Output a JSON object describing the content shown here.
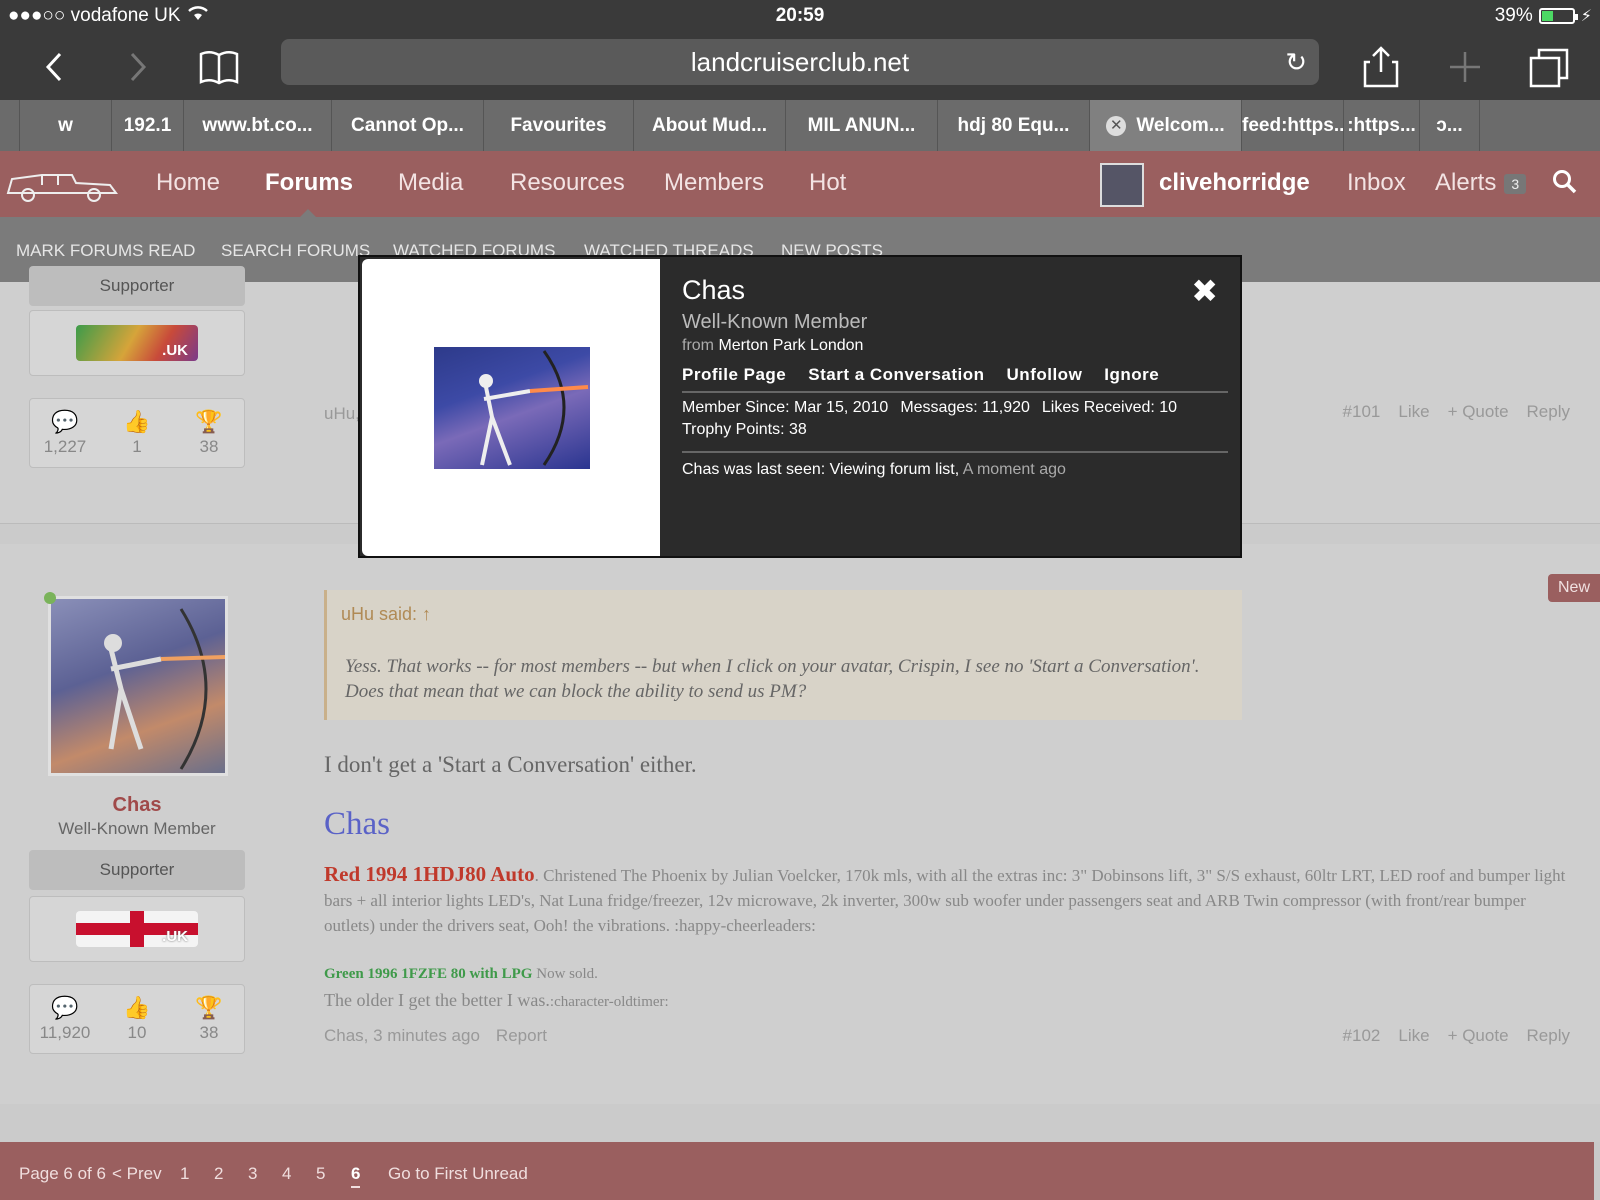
{
  "status_bar": {
    "carrier": "●●●○○ vodafone UK",
    "time": "20:59",
    "battery_percent": "39%",
    "battery_level": 0.39
  },
  "browser": {
    "url": "landcruiserclub.net",
    "tabs": [
      {
        "label": "w"
      },
      {
        "label": "192.1"
      },
      {
        "label": "www.bt.co..."
      },
      {
        "label": "Cannot Op..."
      },
      {
        "label": "Favourites"
      },
      {
        "label": "About Mud..."
      },
      {
        "label": "MIL ANUN..."
      },
      {
        "label": "hdj 80 Equ..."
      },
      {
        "label": "Welcom...",
        "active": true
      },
      {
        "label": "feed:https..."
      },
      {
        "label": ":https..."
      },
      {
        "label": "ɔ..."
      }
    ]
  },
  "nav": {
    "items": [
      "Home",
      "Forums",
      "Media",
      "Resources",
      "Members",
      "Hot"
    ],
    "username": "clivehorridge",
    "inbox": "Inbox",
    "alerts": "Alerts",
    "alerts_count": "3"
  },
  "subnav": {
    "items": [
      "MARK FORUMS READ",
      "SEARCH FORUMS",
      "WATCHED FORUMS",
      "WATCHED THREADS",
      "NEW POSTS"
    ]
  },
  "post101": {
    "supporter": "Supporter",
    "flag_label": ".UK",
    "stats": {
      "messages": "1,227",
      "likes": "1",
      "trophies": "38"
    },
    "author_snippet": "uHu,",
    "number": "#101",
    "like": "Like",
    "quote": "+ Quote",
    "reply": "Reply"
  },
  "post102": {
    "new_badge": "New",
    "author": "Chas",
    "author_title": "Well-Known Member",
    "supporter": "Supporter",
    "flag_label": ".UK",
    "stats": {
      "messages": "11,920",
      "likes": "10",
      "trophies": "38"
    },
    "quote_attr": "uHu said: ↑",
    "quote_text": "Yess. That works -- for most members -- but when I click on your avatar, Crispin, I see no 'Start a Conversation'. Does that mean that we can block the ability to send us PM?",
    "message": "I don't get a 'Start a Conversation' either.",
    "sig_name": "Chas",
    "sig_red": "Red 1994 1HDJ80 Auto",
    "sig_text": ". Christened The Phoenix by Julian Voelcker, 170k mls, with all the extras inc: 3\" Dobinsons lift, 3\" S/S exhaust, 60ltr LRT, LED roof and bumper light bars + all interior lights LED's, Nat Luna fridge/freezer, 12v microwave, 2k inverter, 300w sub woofer under passengers seat and ARB Twin compressor (with front/rear bumper outlets) under the drivers seat, Ooh! the vibrations. :happy-cheerleaders:",
    "sig_green": "Green 1996 1FZFE 80 with LPG",
    "sig_green_tail": " Now sold.",
    "sig_older": "The older I get the better I was.",
    "sig_older_tail": ":character-oldtimer:",
    "posted": "Chas, 3 minutes ago",
    "report": "Report",
    "number": "#102",
    "like": "Like",
    "quote": "+ Quote",
    "reply": "Reply"
  },
  "pagination": {
    "label": "Page 6 of 6",
    "prev": "< Prev",
    "pages": [
      "1",
      "2",
      "3",
      "4",
      "5",
      "6"
    ],
    "current": "6",
    "first_unread": "Go to First Unread"
  },
  "popup": {
    "name": "Chas",
    "title": "Well-Known Member",
    "from_prefix": "from",
    "location": "Merton Park London",
    "links": [
      "Profile Page",
      "Start a Conversation",
      "Unfollow",
      "Ignore"
    ],
    "member_since": "Member Since: Mar 15, 2010",
    "messages": "Messages: 11,920",
    "likes_received": "Likes Received: 10",
    "trophy_points": "Trophy Points: 38",
    "last_seen": "Chas was last seen: Viewing forum list,",
    "last_seen_ago": "A moment ago"
  },
  "colors": {
    "nav_bg": "#9a5f5f",
    "popup_bg": "#2b2b2b",
    "sig_name": "#5a62c7",
    "sig_red": "#c0392b"
  }
}
